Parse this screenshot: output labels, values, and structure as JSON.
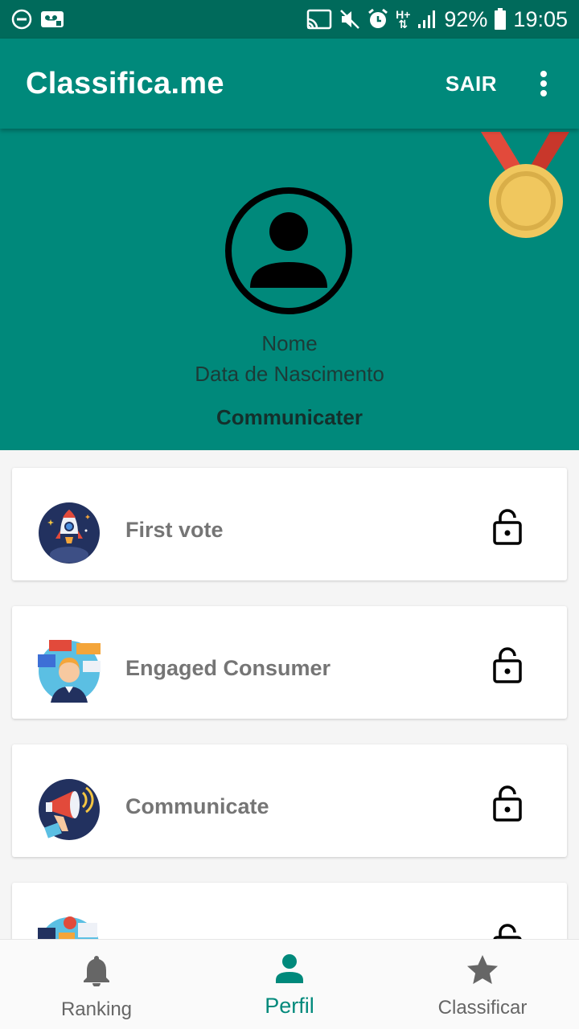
{
  "status_bar": {
    "battery": "92%",
    "time": "19:05",
    "network": "H+",
    "icons": [
      "do-not-disturb-icon",
      "voicemail-icon",
      "cast-icon",
      "mute-icon",
      "alarm-icon",
      "network-icon",
      "signal-icon",
      "battery-icon"
    ]
  },
  "app_bar": {
    "title": "Classifica.me",
    "sair_label": "SAIR",
    "menu_icon": "more-vert-icon"
  },
  "profile": {
    "name": "Nome",
    "birth_date": "Data de Nascimento",
    "rank": "Communicater",
    "avatar_icon": "account-circle-icon",
    "medal_icon": "gold-medal-icon"
  },
  "badges": [
    {
      "label": "First vote",
      "icon": "rocket-icon",
      "locked": true
    },
    {
      "label": "Engaged Consumer",
      "icon": "engaged-consumer-icon",
      "locked": true
    },
    {
      "label": "Communicate",
      "icon": "megaphone-icon",
      "locked": true
    },
    {
      "label": "",
      "icon": "feedback-icon",
      "locked": true
    }
  ],
  "bottom_nav": {
    "items": [
      {
        "label": "Ranking",
        "icon": "bell-icon",
        "active": false
      },
      {
        "label": "Perfil",
        "icon": "person-icon",
        "active": true
      },
      {
        "label": "Classificar",
        "icon": "star-icon",
        "active": false
      }
    ]
  },
  "colors": {
    "primary": "#00897b",
    "primary_dark": "#006a5b",
    "medal_gold": "#f0c75e",
    "medal_ribbon": "#e24a3b",
    "muted_text": "#757575"
  }
}
